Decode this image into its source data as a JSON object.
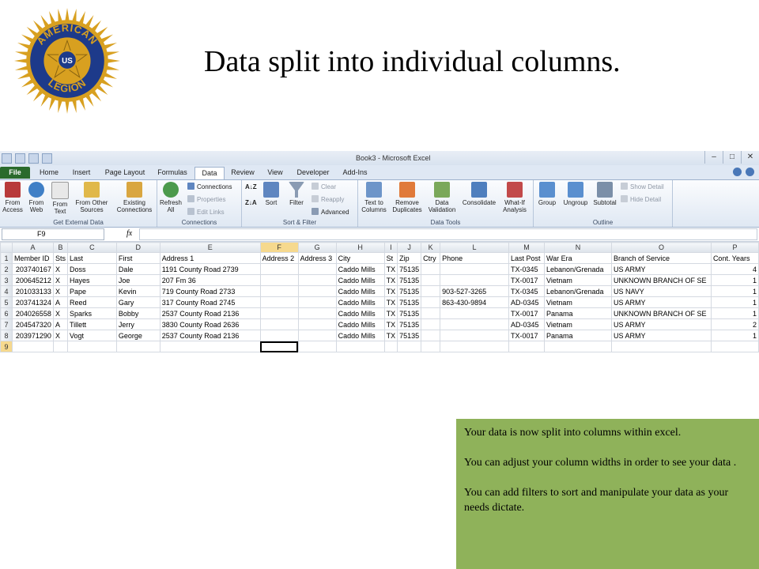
{
  "slide": {
    "title": "Data split into individual columns.",
    "logo": {
      "top_text": "AMERICAN",
      "center_text": "US",
      "bottom_text": "LEGION",
      "colors": {
        "gold": "#d8a020",
        "blue": "#1d3a8a",
        "red": "#b31b1b"
      }
    },
    "note": [
      "Your data is now split into columns within excel.",
      "You can adjust your column widths in order to see your data .",
      "You can add filters to sort and manipulate your data as your needs dictate."
    ],
    "note_color": "#8fb25a"
  },
  "excel": {
    "window_title": "Book3 - Microsoft Excel",
    "window_buttons": [
      "–",
      "□",
      "✕"
    ],
    "tabs": [
      "File",
      "Home",
      "Insert",
      "Page Layout",
      "Formulas",
      "Data",
      "Review",
      "View",
      "Developer",
      "Add-Ins"
    ],
    "active_tab": "Data",
    "ribbon": {
      "get_external": {
        "label": "Get External Data",
        "buttons": [
          "From Access",
          "From Web",
          "From Text",
          "From Other Sources",
          "Existing Connections"
        ]
      },
      "connections": {
        "label": "Connections",
        "refresh": "Refresh All",
        "items": [
          "Connections",
          "Properties",
          "Edit Links"
        ]
      },
      "sort_filter": {
        "label": "Sort & Filter",
        "sort": "Sort",
        "filter": "Filter",
        "items": [
          "Clear",
          "Reapply",
          "Advanced"
        ]
      },
      "data_tools": {
        "label": "Data Tools",
        "buttons": [
          "Text to Columns",
          "Remove Duplicates",
          "Data Validation",
          "Consolidate",
          "What-If Analysis"
        ]
      },
      "outline": {
        "label": "Outline",
        "buttons": [
          "Group",
          "Ungroup",
          "Subtotal"
        ],
        "items": [
          "Show Detail",
          "Hide Detail"
        ]
      }
    },
    "name_box": "F9",
    "fx": "fx",
    "columns": [
      "A",
      "B",
      "C",
      "D",
      "E",
      "F",
      "G",
      "H",
      "I",
      "J",
      "K",
      "L",
      "M",
      "N",
      "O",
      "P"
    ],
    "rows": [
      [
        "Member ID",
        "Sts",
        "Last",
        "First",
        "Address 1",
        "Address 2",
        "Address 3",
        "City",
        "St",
        "Zip",
        "Ctry",
        "Phone",
        "Last Post",
        "War Era",
        "Branch of Service",
        "Cont. Years"
      ],
      [
        "203740167",
        "X",
        "Doss",
        "Dale",
        "1191 County Road 2739",
        "",
        "",
        "Caddo Mills",
        "TX",
        "75135",
        "",
        "",
        "TX-0345",
        "Lebanon/Grenada",
        "US ARMY",
        "4"
      ],
      [
        "200645212",
        "X",
        "Hayes",
        "Joe",
        "207 Fm 36",
        "",
        "",
        "Caddo Mills",
        "TX",
        "75135",
        "",
        "",
        "TX-0017",
        "Vietnam",
        "UNKNOWN BRANCH OF SE",
        "1"
      ],
      [
        "201033133",
        "X",
        "Pape",
        "Kevin",
        "719 County Road 2733",
        "",
        "",
        "Caddo Mills",
        "TX",
        "75135",
        "",
        "903-527-3265",
        "TX-0345",
        "Lebanon/Grenada",
        "US NAVY",
        "1"
      ],
      [
        "203741324",
        "A",
        "Reed",
        "Gary",
        "317 County Road 2745",
        "",
        "",
        "Caddo Mills",
        "TX",
        "75135",
        "",
        "863-430-9894",
        "AD-0345",
        "Vietnam",
        "US ARMY",
        "1"
      ],
      [
        "204026558",
        "X",
        "Sparks",
        "Bobby",
        "2537 County Road 2136",
        "",
        "",
        "Caddo Mills",
        "TX",
        "75135",
        "",
        "",
        "TX-0017",
        "Panama",
        "UNKNOWN BRANCH OF SE",
        "1"
      ],
      [
        "204547320",
        "A",
        "Tillett",
        "Jerry",
        "3830 County Road 2636",
        "",
        "",
        "Caddo Mills",
        "TX",
        "75135",
        "",
        "",
        "AD-0345",
        "Vietnam",
        "US ARMY",
        "2"
      ],
      [
        "203971290",
        "X",
        "Vogt",
        "George",
        "2537 County Road 2136",
        "",
        "",
        "Caddo Mills",
        "TX",
        "75135",
        "",
        "",
        "TX-0017",
        "Panama",
        "US ARMY",
        "1"
      ],
      [
        "",
        "",
        "",
        "",
        "",
        "",
        "",
        "",
        "",
        "",
        "",
        "",
        "",
        "",
        "",
        ""
      ]
    ]
  }
}
